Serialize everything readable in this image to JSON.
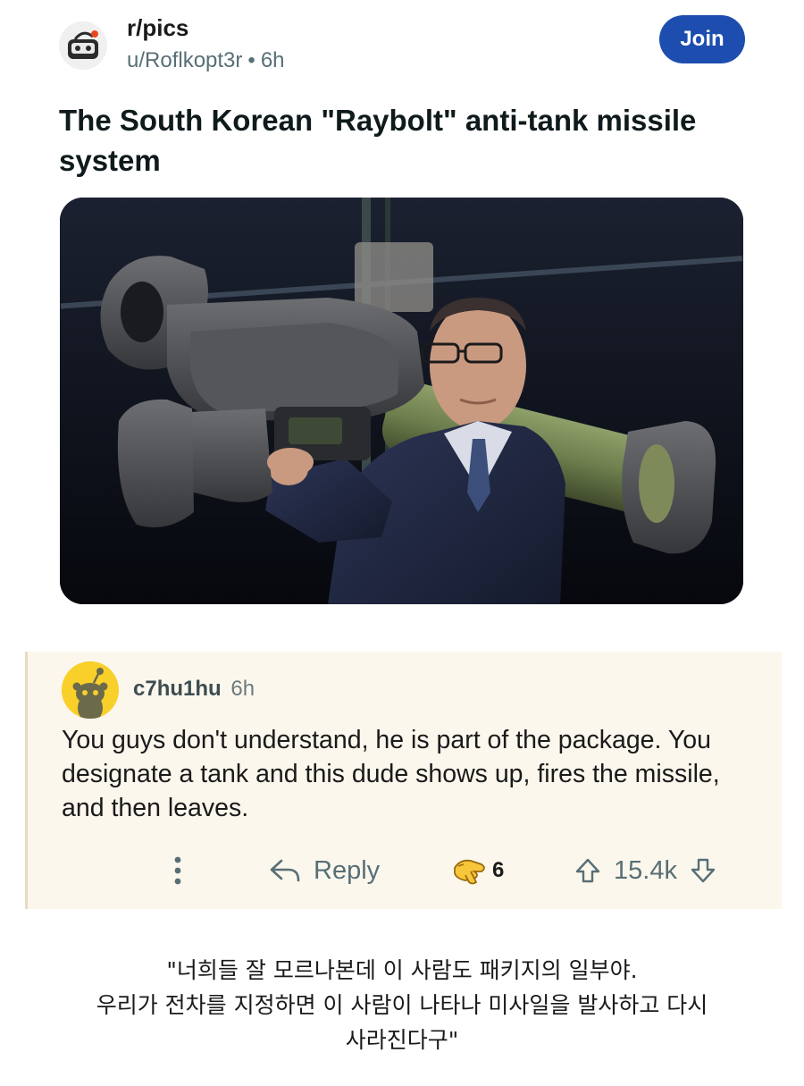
{
  "post": {
    "subreddit": "r/pics",
    "author": "u/Roflkopt3r",
    "time": "6h",
    "join_label": "Join",
    "title": "The South Korean \"Raybolt\" anti-tank missile system"
  },
  "comment": {
    "username": "c7hu1hu",
    "time": "6h",
    "body": "You guys don't understand, he is part of the package. You designate a tank and this dude shows up, fires the missile, and then leaves.",
    "reply_label": "Reply",
    "award_count": "6",
    "score": "15.4k"
  },
  "caption": {
    "line1": "\"너희들 잘 모르나본데 이 사람도 패키지의 일부야.",
    "line2": "우리가 전차를 지정하면 이 사람이 나타나 미사일을 발사하고 다시",
    "line3": "사라진다구\""
  },
  "icons": {
    "subreddit_avatar": "subreddit-avatar-icon",
    "more": "more-vertical-icon",
    "reply": "reply-arrow-icon",
    "award": "award-hand-icon",
    "upvote": "upvote-arrow-icon",
    "downvote": "downvote-arrow-icon"
  },
  "colors": {
    "join_button": "#1d4eaf",
    "comment_background": "#fcf7ec",
    "comment_avatar": "#f9cf2a",
    "meta_text": "#576f76"
  }
}
